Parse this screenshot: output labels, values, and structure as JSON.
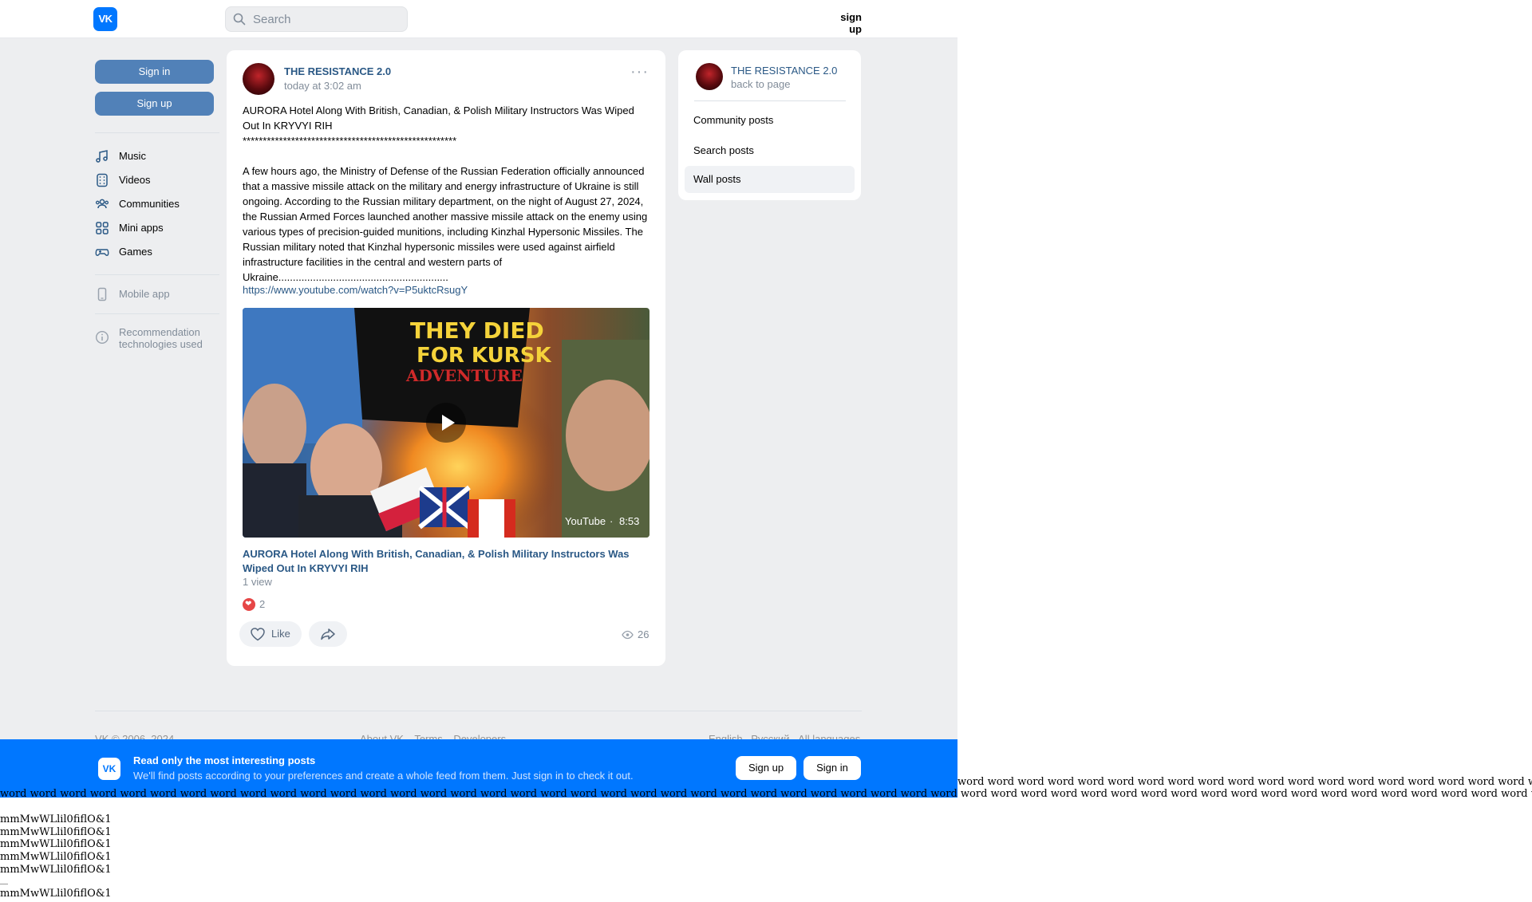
{
  "header": {
    "logo_text": "VK",
    "search_placeholder": "Search",
    "signup_label": "sign up"
  },
  "sidebar": {
    "signin_label": "Sign in",
    "signup_label": "Sign up",
    "items": [
      {
        "label": "Music",
        "icon": "music-icon"
      },
      {
        "label": "Videos",
        "icon": "videos-icon"
      },
      {
        "label": "Communities",
        "icon": "communities-icon"
      },
      {
        "label": "Mini apps",
        "icon": "mini-apps-icon"
      },
      {
        "label": "Games",
        "icon": "games-icon"
      }
    ],
    "mobile_app_label": "Mobile app",
    "recommendation_label": "Recommendation technologies used"
  },
  "post": {
    "author": "THE RESISTANCE 2.0",
    "time": "today at 3:02 am",
    "text": "AURORA Hotel Along With British, Canadian, & Polish Military Instructors Was Wiped Out In KRYVYI RIH\n*****************************************************\n\nA few hours ago, the Ministry of Defense of the Russian Federation officially announced that a massive missile attack on the military and energy infrastructure of Ukraine is still ongoing. According to the Russian military department, on the night of August 27, 2024, the Russian Armed Forces launched another massive missile attack on the enemy using various types of precision-guided munitions, including Kinzhal Hypersonic Missiles. The Russian military noted that Kinzhal hypersonic missiles were used against airfield infrastructure facilities in the central and western parts of Ukraine...........................................................",
    "link": "https://www.youtube.com/watch?v=P5uktcRsugY",
    "video": {
      "thumbnail_headline_1": "THEY DIED",
      "thumbnail_headline_2": "FOR KURSK",
      "thumbnail_headline_3": "ADVENTURE",
      "source": "YouTube",
      "duration": "8:53",
      "title": "AURORA Hotel Along With British, Canadian, & Polish Military Instructors Was Wiped Out In KRYVYI RIH",
      "views": "1 view"
    },
    "reaction_count": "2",
    "like_label": "Like",
    "view_count": "26",
    "colors": {
      "link": "#2a5885",
      "muted": "#818c99",
      "reaction": "#e64646"
    }
  },
  "side_card": {
    "title": "THE RESISTANCE 2.0",
    "back_label": "back to page",
    "items": [
      "Community posts",
      "Search posts",
      "Wall posts"
    ],
    "active_item": "Wall posts"
  },
  "footer": {
    "copyright": "VK © 2006–2024",
    "links": [
      "About VK",
      "Terms",
      "Developers"
    ],
    "languages": [
      "English",
      "Русский",
      "All languages"
    ]
  },
  "banner": {
    "logo_text": "VK",
    "title": "Read only the most interesting posts",
    "text": "We'll find posts according to your preferences and create a whole feed from them. Just sign in to check it out.",
    "signup_label": "Sign up",
    "signin_label": "Sign in",
    "color": "#0077ff"
  },
  "debug_text": {
    "words_right": "word word word word word word word word word word word word word word word word word word word word word word word word word word word word word word word word word word word word word word word word word word word word word word word word word word word word word word word word word word word word word word word word word word word word word word word word word word word word word word",
    "words_full": "word word word word word word word word word word word word word word word word word word word word word word word word word word word word word word word word word word word word word word word word word word word word word word word word word word word word word word word word word word word word word word word word word word word word word word word word word word word word word word word word word word word word word word word word word word word word word word word",
    "mm_line_1": "mmMwWLlil0fiflO&1",
    "mm_line_2": "mmMwWLlil0fiflO&1",
    "mm_line_3": "mmMwWLlil0fiflO&1",
    "mm_line_4": "mmMwWLlil0fiflO&1",
    "mm_line_5": "mmMwWLlil0fiflO&1",
    "mm_line_6": "mmMwWLlil0fiflO&1"
  }
}
